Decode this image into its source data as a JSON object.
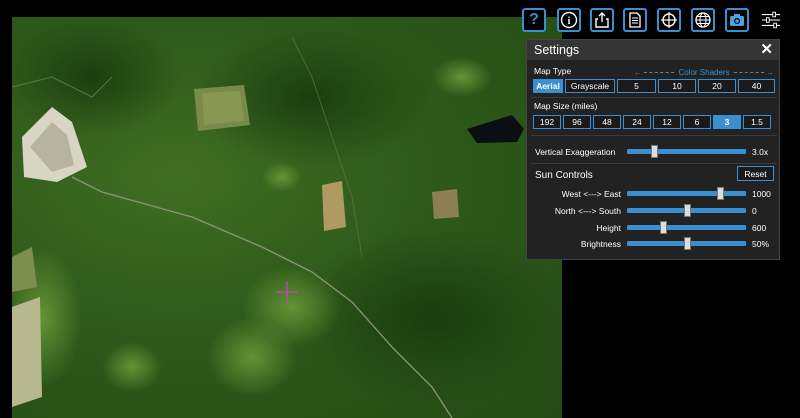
{
  "toolbar": {
    "buttons": [
      {
        "name": "help-icon",
        "glyph": "?"
      },
      {
        "name": "info-icon",
        "glyph": "i"
      },
      {
        "name": "share-icon",
        "glyph": "share"
      },
      {
        "name": "document-icon",
        "glyph": "doc"
      },
      {
        "name": "crosshair-icon",
        "glyph": "target"
      },
      {
        "name": "globe-icon",
        "glyph": "globe"
      },
      {
        "name": "camera-icon",
        "glyph": "camera"
      },
      {
        "name": "sliders-icon",
        "glyph": "sliders"
      }
    ]
  },
  "settings": {
    "title": "Settings",
    "close": "✕",
    "map_type": {
      "label": "Map Type",
      "color_shaders_label": "Color Shaders",
      "options": [
        "Aerial",
        "Grayscale",
        "5",
        "10",
        "20",
        "40"
      ],
      "selected": "Aerial"
    },
    "map_size": {
      "label": "Map Size (miles)",
      "options": [
        "192",
        "96",
        "48",
        "24",
        "12",
        "6",
        "3",
        "1.5"
      ],
      "selected": "3"
    },
    "vertical_exaggeration": {
      "label": "Vertical Exaggeration",
      "value": "3.0x",
      "level": 0.23
    },
    "sun_controls": {
      "title": "Sun Controls",
      "reset_label": "Reset",
      "sliders": [
        {
          "label": "West <---> East",
          "value": "1000",
          "level": 0.78
        },
        {
          "label": "North <---> South",
          "value": "0",
          "level": 0.5
        },
        {
          "label": "Height",
          "value": "600",
          "level": 0.3
        },
        {
          "label": "Brightness",
          "value": "50%",
          "level": 0.5
        }
      ]
    }
  },
  "colors": {
    "accent": "#3a8fd0",
    "panel_bg": "#222222",
    "header_bg": "#353535",
    "forest": "#2d5a1a",
    "marker": "#d040c0"
  }
}
